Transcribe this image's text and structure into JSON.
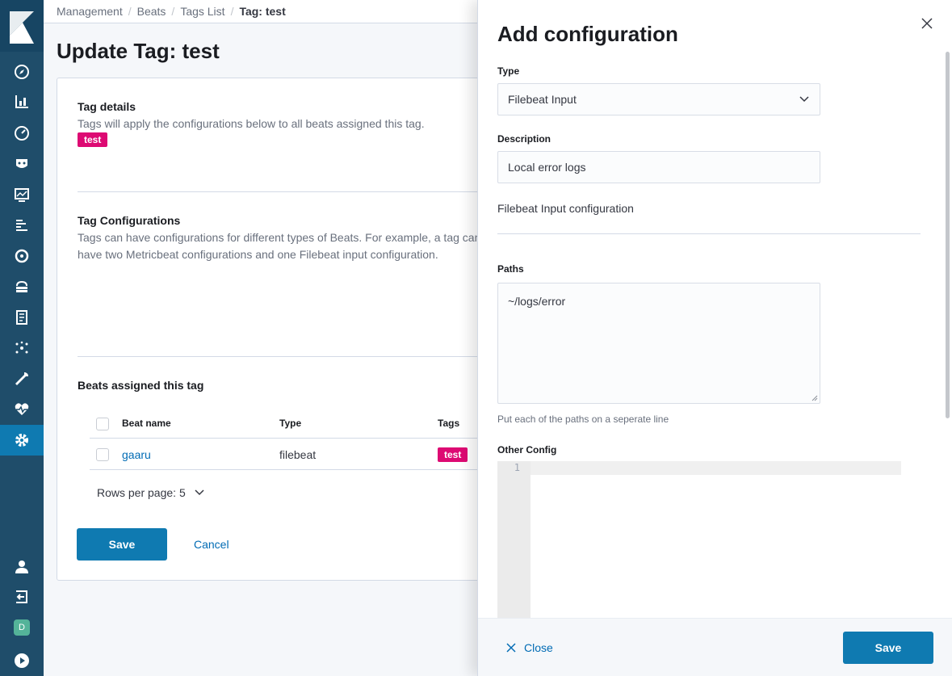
{
  "breadcrumbs": [
    "Management",
    "Beats",
    "Tags List",
    "Tag: test"
  ],
  "page": {
    "title": "Update Tag: test"
  },
  "tag_details": {
    "title": "Tag details",
    "text": "Tags will apply the configurations below to all beats assigned this tag.",
    "badge": "test"
  },
  "tag_configurations": {
    "title": "Tag Configurations",
    "text": "Tags can have configurations for different types of Beats. For example, a tag can have two Metricbeat configurations and one Filebeat input configuration."
  },
  "beats": {
    "title": "Beats assigned this tag",
    "columns": [
      "Beat name",
      "Type",
      "Tags"
    ],
    "rows": [
      {
        "name": "gaaru",
        "type": "filebeat",
        "tag": "test"
      }
    ],
    "rows_per_page": "Rows per page: 5"
  },
  "buttons": {
    "save": "Save",
    "cancel": "Cancel"
  },
  "flyout": {
    "title": "Add configuration",
    "type_label": "Type",
    "type_value": "Filebeat Input",
    "description_label": "Description",
    "description_value": "Local error logs",
    "section_title": "Filebeat Input configuration",
    "paths_label": "Paths",
    "paths_value": "~/logs/error",
    "paths_help": "Put each of the paths on a seperate line",
    "other_config_label": "Other Config",
    "editor_line": "1",
    "close_label": "Close",
    "save_label": "Save"
  },
  "user": {
    "avatar_letter": "D"
  },
  "colors": {
    "primary": "#0f7ab1",
    "badge": "#dd0a73",
    "sidebar": "#1f4d6a",
    "link": "#006bb4"
  },
  "icons": [
    "discover-icon",
    "visualize-icon",
    "dashboard-icon",
    "canvas-icon",
    "maps-icon",
    "logs-icon",
    "apm-icon",
    "infrastructure-icon",
    "uptime-icon",
    "graph-icon",
    "dev-tools-icon",
    "monitoring-icon",
    "management-icon",
    "user-icon",
    "logout-icon",
    "help-icon"
  ]
}
